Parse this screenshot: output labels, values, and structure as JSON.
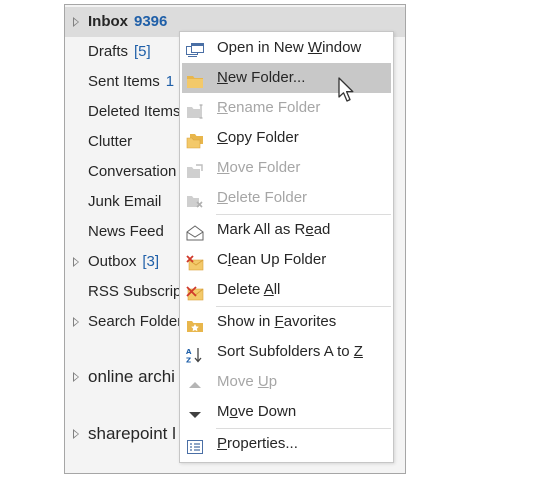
{
  "folders": [
    {
      "name": "Inbox",
      "count": "9396",
      "bold": true,
      "caret": true,
      "selected": true
    },
    {
      "name": "Drafts",
      "count": "[5]",
      "bold": false,
      "caret": false
    },
    {
      "name": "Sent Items",
      "count": "1",
      "bold": false,
      "caret": false
    },
    {
      "name": "Deleted Items",
      "count": "",
      "bold": false,
      "caret": false
    },
    {
      "name": "Clutter",
      "count": "",
      "bold": false,
      "caret": false
    },
    {
      "name": "Conversation",
      "count": "",
      "bold": false,
      "caret": false
    },
    {
      "name": "Junk Email",
      "count": "",
      "bold": false,
      "caret": false
    },
    {
      "name": "News Feed",
      "count": "",
      "bold": false,
      "caret": false
    },
    {
      "name": "Outbox",
      "count": "[3]",
      "bold": false,
      "caret": true
    },
    {
      "name": "RSS Subscript",
      "count": "",
      "bold": false,
      "caret": false
    },
    {
      "name": "Search Folder",
      "count": "",
      "bold": false,
      "caret": true
    },
    {
      "name": "online archi",
      "count": "",
      "bold": false,
      "caret": true,
      "big": true
    },
    {
      "name": "sharepoint l",
      "count": "",
      "bold": false,
      "caret": true,
      "big": true
    }
  ],
  "ellipsis": "...",
  "menu": {
    "items": [
      {
        "label": "Open in New Window",
        "underline": "W",
        "icon": "open-window-icon",
        "disabled": false
      },
      {
        "label": "New Folder...",
        "underline": "N",
        "icon": "new-folder-icon",
        "disabled": false,
        "highlight": true
      },
      {
        "label": "Rename Folder",
        "underline": "R",
        "icon": "rename-folder-icon",
        "disabled": true
      },
      {
        "label": "Copy Folder",
        "underline": "C",
        "icon": "copy-folder-icon",
        "disabled": false
      },
      {
        "label": "Move Folder",
        "underline": "M",
        "icon": "move-folder-icon",
        "disabled": true
      },
      {
        "label": "Delete Folder",
        "underline": "D",
        "icon": "delete-folder-icon",
        "disabled": true,
        "sep_after": true
      },
      {
        "label": "Mark All as Read",
        "underline": "e",
        "icon": "mark-read-icon",
        "disabled": false
      },
      {
        "label": "Clean Up Folder",
        "underline": "l",
        "icon": "clean-up-icon",
        "disabled": false
      },
      {
        "label": "Delete All",
        "underline": "A",
        "icon": "delete-all-icon",
        "disabled": false,
        "sep_after": true
      },
      {
        "label": "Show in Favorites",
        "underline": "F",
        "icon": "favorites-icon",
        "disabled": false
      },
      {
        "label": "Sort Subfolders A to Z",
        "underline": "Z",
        "icon": "sort-az-icon",
        "disabled": false
      },
      {
        "label": "Move Up",
        "underline": "U",
        "icon": "move-up-icon",
        "disabled": true
      },
      {
        "label": "Move Down",
        "underline": "o",
        "icon": "move-down-icon",
        "disabled": false,
        "sep_after": true
      },
      {
        "label": "Properties...",
        "underline": "P",
        "icon": "properties-icon",
        "disabled": false
      }
    ]
  },
  "colors": {
    "count": "#1f5fa8",
    "highlight": "#c8c8c8",
    "folder_icon": "#e8b64c",
    "disabled": "#a6a6a6",
    "delete_red": "#d0392b"
  }
}
